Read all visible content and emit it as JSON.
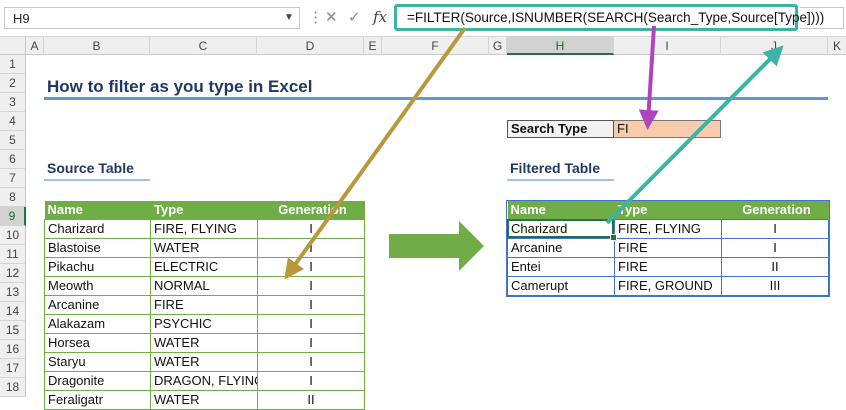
{
  "formula_bar": {
    "name_box": "H9",
    "formula": "=FILTER(Source,ISNUMBER(SEARCH(Search_Type,Source[Type])))",
    "icons": [
      "more-options-icon",
      "cancel-icon",
      "enter-icon",
      "function-icon"
    ]
  },
  "columns": [
    "A",
    "B",
    "C",
    "D",
    "E",
    "F",
    "G",
    "H",
    "I",
    "J",
    "K"
  ],
  "rows": [
    "1",
    "2",
    "3",
    "4",
    "5",
    "6",
    "7",
    "8",
    "9",
    "10",
    "11",
    "12",
    "13",
    "14",
    "15",
    "16",
    "17",
    "18"
  ],
  "selected": {
    "column": "H",
    "row": "9"
  },
  "title": "How to filter as you type in Excel",
  "search": {
    "label": "Search Type",
    "value": "FI"
  },
  "source_table": {
    "heading": "Source Table",
    "headers": [
      "Name",
      "Type",
      "Generation"
    ],
    "rows": [
      [
        "Charizard",
        "FIRE, FLYING",
        "I"
      ],
      [
        "Blastoise",
        "WATER",
        "I"
      ],
      [
        "Pikachu",
        "ELECTRIC",
        "I"
      ],
      [
        "Meowth",
        "NORMAL",
        "I"
      ],
      [
        "Arcanine",
        "FIRE",
        "I"
      ],
      [
        "Alakazam",
        "PSYCHIC",
        "I"
      ],
      [
        "Horsea",
        "WATER",
        "I"
      ],
      [
        "Staryu",
        "WATER",
        "I"
      ],
      [
        "Dragonite",
        "DRAGON, FLYING",
        "I"
      ],
      [
        "Feraligatr",
        "WATER",
        "II"
      ]
    ]
  },
  "filtered_table": {
    "heading": "Filtered Table",
    "headers": [
      "Name",
      "Type",
      "Generation"
    ],
    "rows": [
      [
        "Charizard",
        "FIRE, FLYING",
        "I"
      ],
      [
        "Arcanine",
        "FIRE",
        "I"
      ],
      [
        "Entei",
        "FIRE",
        "II"
      ],
      [
        "Camerupt",
        "FIRE, GROUND",
        "III"
      ]
    ]
  },
  "colors": {
    "formula_highlight": "#3bb4a3",
    "source_arrow": "#b8993a",
    "search_arrow": "#b043c0",
    "filtered_arrow": "#3bb4a3",
    "big_arrow": "#70ad47",
    "table_header": "#70ad47"
  }
}
